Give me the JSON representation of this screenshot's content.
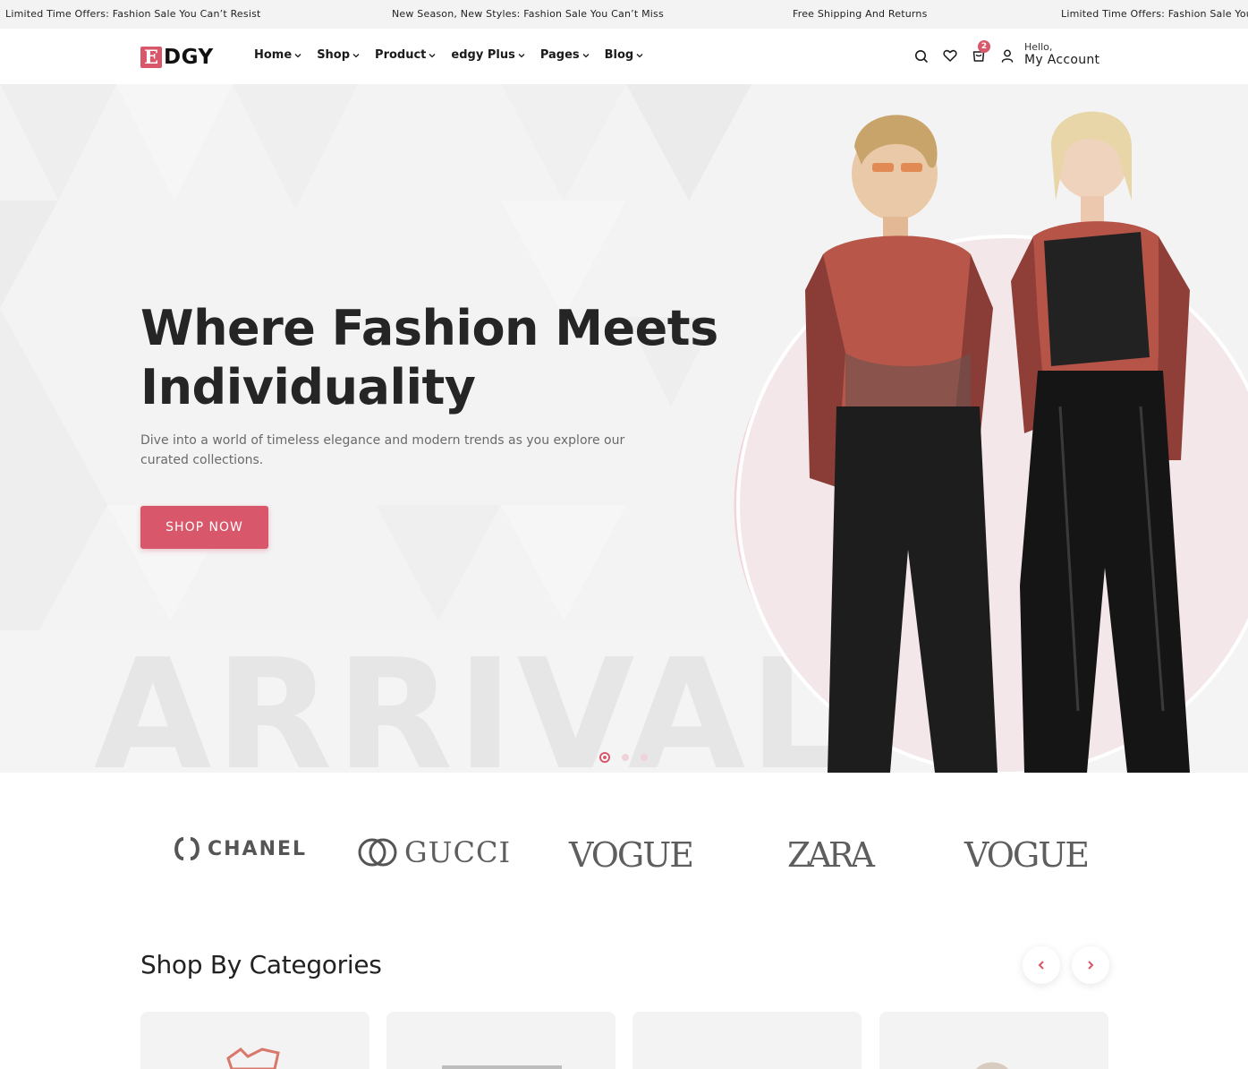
{
  "announcements": [
    "Limited Time Offers: Fashion Sale You Can’t Resist",
    "New Season, New Styles: Fashion Sale You Can’t Miss",
    "Free Shipping And Returns",
    "Limited Time Offers: Fashion Sale You Can’t Resist"
  ],
  "header": {
    "logo_mark": "E",
    "logo_text": "DGY",
    "nav": [
      {
        "label": "Home"
      },
      {
        "label": "Shop"
      },
      {
        "label": "Product"
      },
      {
        "label": "edgy Plus"
      },
      {
        "label": "Pages"
      },
      {
        "label": "Blog"
      }
    ],
    "cart_count": "2",
    "account_greeting": "Hello,",
    "account_label": "My Account"
  },
  "hero": {
    "title_line1": "Where Fashion Meets",
    "title_line2": "Individuality",
    "subtitle": "Dive into a world of timeless elegance and modern trends as you explore our curated collections.",
    "cta": "SHOP NOW",
    "watermark": "ARRIVAL",
    "slide_count": 3,
    "active_slide": 1
  },
  "brands": [
    "CHANEL",
    "GUCCI",
    "VOGUE",
    "ZARA",
    "VOGUE"
  ],
  "categories": {
    "title": "Shop By Categories"
  },
  "colors": {
    "accent": "#d9576a",
    "text": "#1e1e1e",
    "muted": "#6a6a6a",
    "hero_bg": "#f3f3f3"
  }
}
